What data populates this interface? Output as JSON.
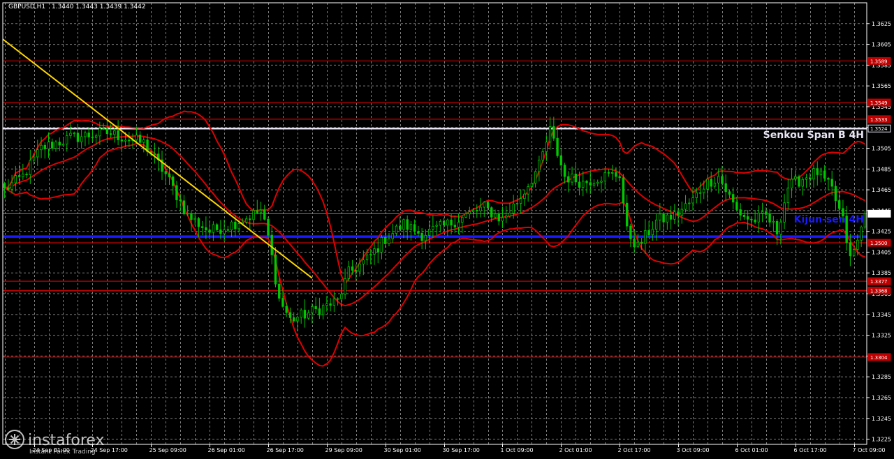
{
  "header": {
    "symbol": "GBPUSD,H1",
    "ohlc": "1.3440 1.3443 1.3439 1.3442"
  },
  "watermark": {
    "name": "instaforex",
    "tagline": "Instant Forex Trading"
  },
  "colors": {
    "background": "#000000",
    "grid": "#7f7f7f",
    "frame": "#ffffff",
    "candle": "#00c800",
    "level": "#c00000",
    "bollinger": "#e00000",
    "trendline": "#ffd700",
    "senkou": "#e8e4f4",
    "kijun": "#1a1aff"
  },
  "chart_data": {
    "type": "candlestick",
    "symbol": "GBPUSD",
    "timeframe": "H1",
    "ylim": [
      1.322,
      1.3645
    ],
    "y_ticks": [
      "1.3625",
      "1.3605",
      "1.3585",
      "1.3565",
      "1.3545",
      "1.3525",
      "1.3505",
      "1.3485",
      "1.3465",
      "1.3445",
      "1.3425",
      "1.3405",
      "1.3385",
      "1.3365",
      "1.3345",
      "1.3325",
      "1.3305",
      "1.3285",
      "1.3265",
      "1.3245",
      "1.3225"
    ],
    "x_ticks": [
      {
        "i": 8,
        "label": "24 Sep 01:00"
      },
      {
        "i": 24,
        "label": "24 Sep 17:00"
      },
      {
        "i": 40,
        "label": "25 Sep 09:00"
      },
      {
        "i": 56,
        "label": "26 Sep 01:00"
      },
      {
        "i": 72,
        "label": "26 Sep 17:00"
      },
      {
        "i": 88,
        "label": "29 Sep 09:00"
      },
      {
        "i": 104,
        "label": "30 Sep 01:00"
      },
      {
        "i": 120,
        "label": "30 Sep 17:00"
      },
      {
        "i": 136,
        "label": "1 Oct 09:00"
      },
      {
        "i": 152,
        "label": "2 Oct 01:00"
      },
      {
        "i": 168,
        "label": "2 Oct 17:00"
      },
      {
        "i": 184,
        "label": "3 Oct 09:00"
      },
      {
        "i": 200,
        "label": "6 Oct 01:00"
      },
      {
        "i": 216,
        "label": "6 Oct 17:00"
      },
      {
        "i": 232,
        "label": "7 Oct 09:00"
      }
    ],
    "close_anchors": [
      [
        0,
        1.3465
      ],
      [
        5,
        1.3478
      ],
      [
        10,
        1.3505
      ],
      [
        18,
        1.3515
      ],
      [
        28,
        1.352
      ],
      [
        38,
        1.351
      ],
      [
        44,
        1.348
      ],
      [
        50,
        1.344
      ],
      [
        56,
        1.3425
      ],
      [
        62,
        1.3432
      ],
      [
        66,
        1.3438
      ],
      [
        70,
        1.3445
      ],
      [
        72,
        1.342
      ],
      [
        75,
        1.336
      ],
      [
        78,
        1.334
      ],
      [
        82,
        1.3345
      ],
      [
        87,
        1.3352
      ],
      [
        91,
        1.3358
      ],
      [
        94,
        1.3385
      ],
      [
        99,
        1.3398
      ],
      [
        104,
        1.3418
      ],
      [
        109,
        1.3432
      ],
      [
        114,
        1.3422
      ],
      [
        120,
        1.343
      ],
      [
        126,
        1.344
      ],
      [
        131,
        1.3448
      ],
      [
        136,
        1.3436
      ],
      [
        141,
        1.3458
      ],
      [
        146,
        1.3488
      ],
      [
        149,
        1.3522
      ],
      [
        153,
        1.3478
      ],
      [
        158,
        1.3472
      ],
      [
        163,
        1.3478
      ],
      [
        168,
        1.348
      ],
      [
        170,
        1.3425
      ],
      [
        173,
        1.341
      ],
      [
        178,
        1.3435
      ],
      [
        183,
        1.344
      ],
      [
        188,
        1.3455
      ],
      [
        191,
        1.347
      ],
      [
        195,
        1.3478
      ],
      [
        200,
        1.3445
      ],
      [
        204,
        1.3435
      ],
      [
        208,
        1.344
      ],
      [
        211,
        1.3425
      ],
      [
        214,
        1.3468
      ],
      [
        219,
        1.3478
      ],
      [
        222,
        1.3482
      ],
      [
        226,
        1.3465
      ],
      [
        229,
        1.3435
      ],
      [
        231,
        1.3398
      ],
      [
        233,
        1.3415
      ],
      [
        235,
        1.3442
      ]
    ],
    "levels": [
      {
        "label": "1.3589",
        "value": 1.3589
      },
      {
        "label": "1.3549",
        "value": 1.3549
      },
      {
        "label": "1.3533",
        "value": 1.3533
      },
      {
        "label": "1.3500",
        "value": 1.3414
      },
      {
        "label": "1.3377",
        "value": 1.3377
      },
      {
        "label": "1.3368",
        "value": 1.3368
      },
      {
        "label": "1.3304",
        "value": 1.3304
      }
    ],
    "senkou_span_b": {
      "label": "Senkou Span B 4H",
      "value": 1.3524
    },
    "kijun_sen": {
      "label": "Kijun-sen 4H",
      "value": 1.342
    },
    "current_price": {
      "label": "1.3442",
      "value": 1.3442
    },
    "trendline": {
      "from": {
        "i": -0.5,
        "price": 1.361
      },
      "to": {
        "i": 84,
        "price": 1.338
      }
    },
    "bollinger": {
      "period": 20,
      "deviations": 2
    }
  }
}
